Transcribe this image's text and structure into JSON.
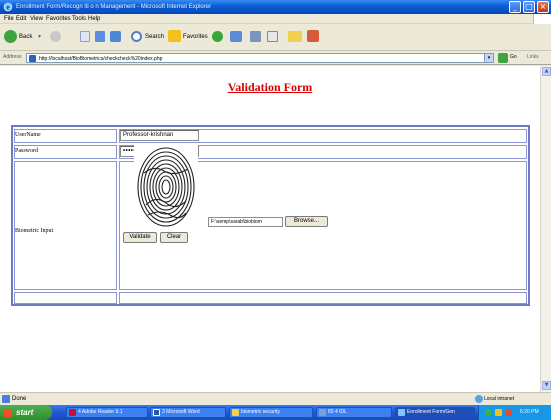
{
  "window": {
    "title": "Enrollment Form/Recogn iti o n Management - Microsoft Internet Explorer",
    "min_label": "_",
    "max_label": "□",
    "close_label": "×"
  },
  "menu": [
    "File",
    "Edit",
    "View",
    "Favorites",
    "Tools",
    "Help"
  ],
  "toolbar": {
    "back_label": "Back",
    "search_label": "Search",
    "favorites_label": "Favorites"
  },
  "address": {
    "label": "Address",
    "url": "http://localhost/BioBiometrics/checkcheck%20index.php",
    "go_label": "Go",
    "links_label": "Links"
  },
  "page": {
    "title": "Validation Form",
    "username_label": "UserName",
    "username_value": "Professor-krishnan",
    "password_label": "Password",
    "password_value": "••••••••",
    "biometric_label": "Biometric Input",
    "file_path": "F:\\semp\\sarab\\biobiom",
    "browse_label": "Browse...",
    "validate_label": "Validate",
    "clear_label": "Clear"
  },
  "status": {
    "text": "Done",
    "zone": "Local intranet"
  },
  "taskbar": {
    "start_label": "start",
    "tasks": [
      "4 Adobe Reader 9.1",
      "3 Microsoft Word",
      "biometric security",
      "80 4 IDL",
      "Enrollment Form/Gen"
    ],
    "clock": "6:20 PM"
  },
  "colors": {
    "title_red": "#d80000",
    "table_border": "#6d79c8",
    "xp_blue": "#0a5fd8",
    "start_green": "#3a9a3a"
  }
}
